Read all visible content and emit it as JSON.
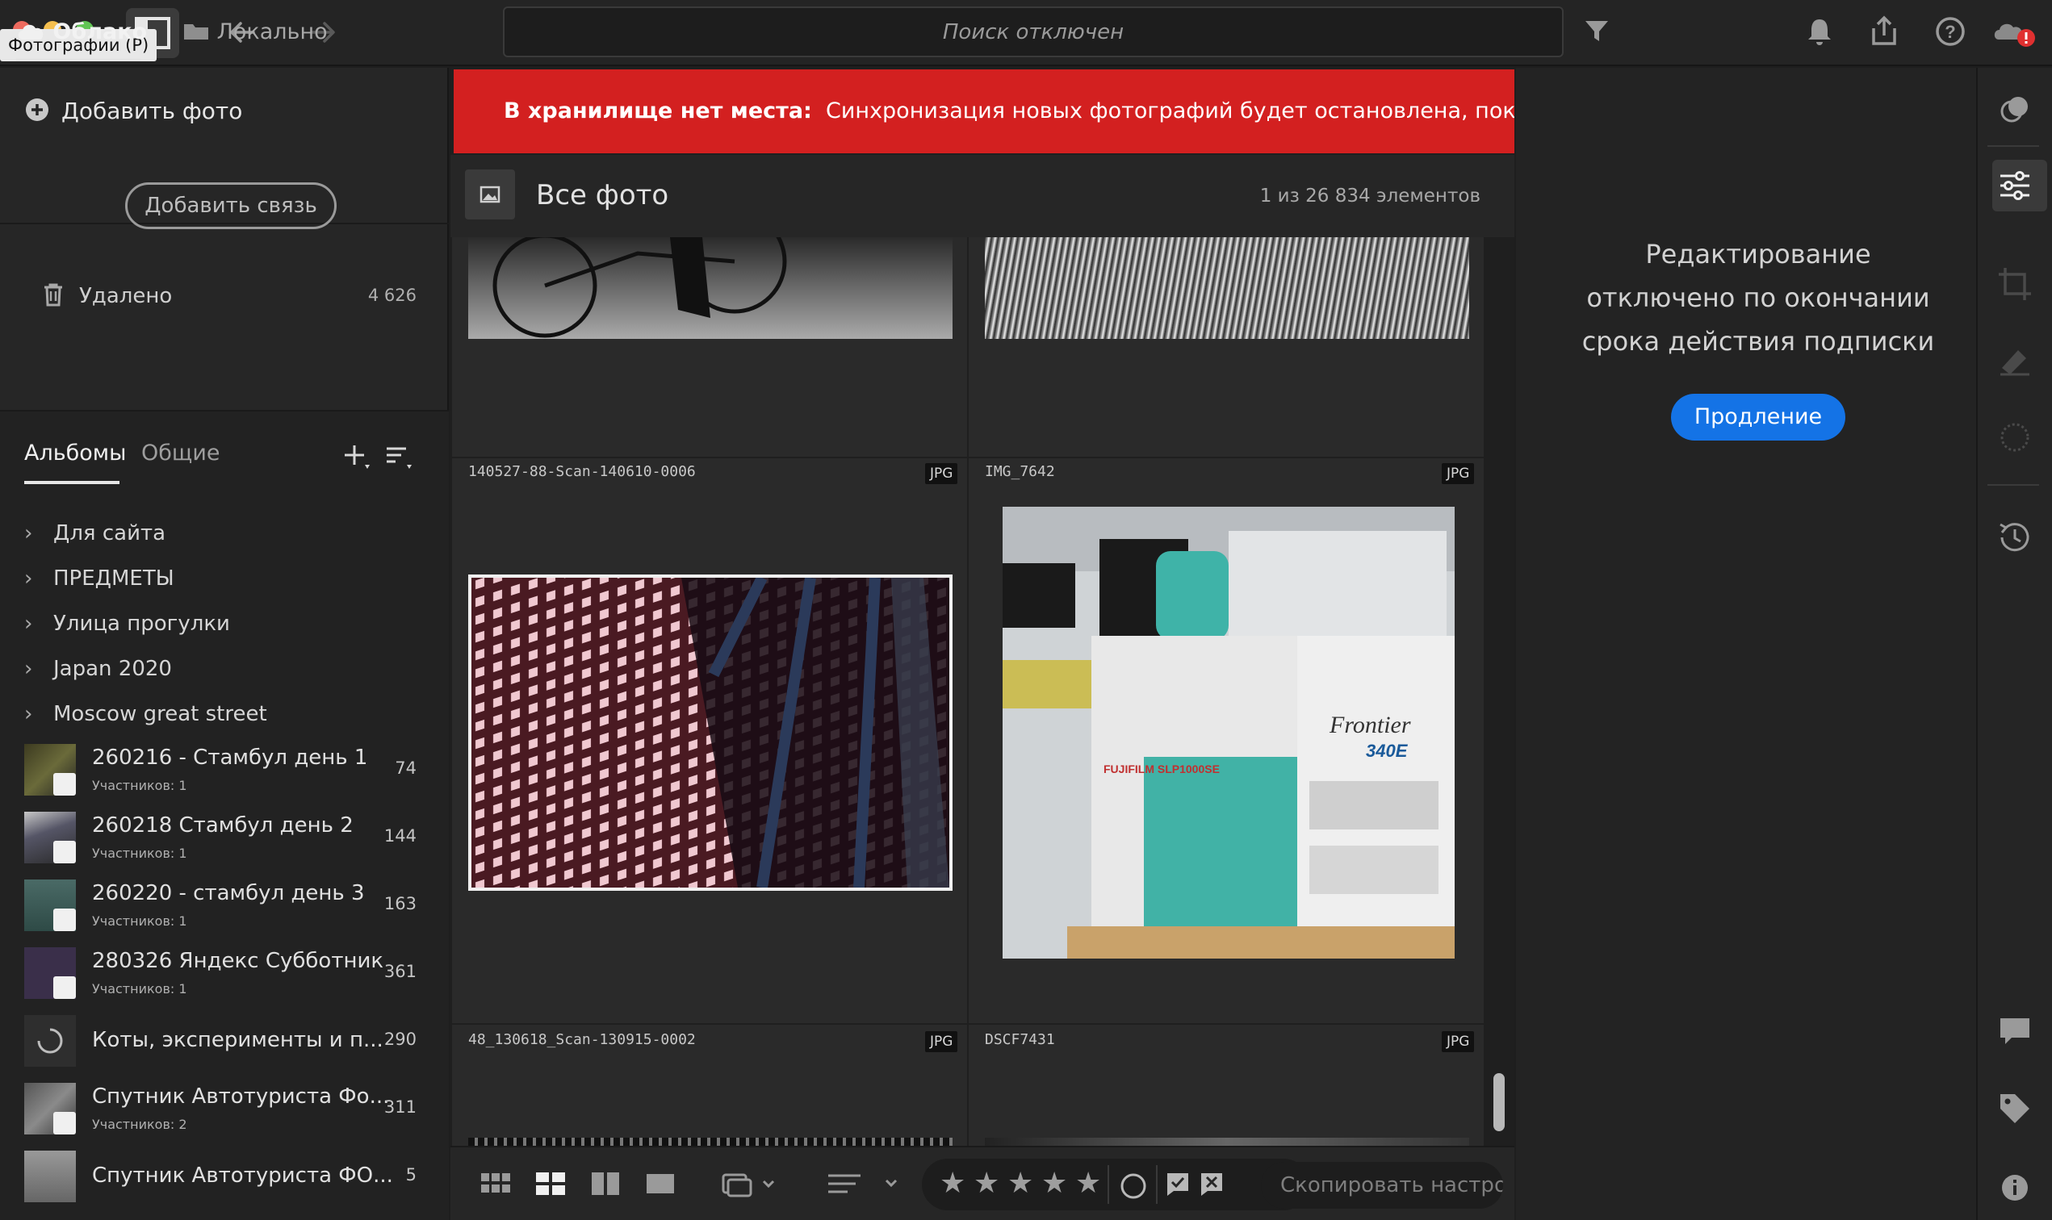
{
  "window": {
    "tooltip": "Фотографии (P)",
    "traffic_colors": [
      "#ed6a5e",
      "#f5bf4f",
      "#61c554"
    ]
  },
  "toolbar": {
    "search_placeholder": "Поиск отключен",
    "icons": [
      "back-arrow-icon",
      "forward-arrow-icon",
      "filter-icon",
      "bell-icon",
      "share-icon",
      "help-icon",
      "cloud-error-icon"
    ]
  },
  "sidebar": {
    "tab_cloud": "Облако",
    "tab_local": "Локально",
    "add_photo": "Добавить фото",
    "add_link": "Добавить связь",
    "deleted": {
      "label": "Удалено",
      "count": "4 626"
    },
    "tab_albums": "Альбомы",
    "tab_shared": "Общие",
    "folders": [
      "Для сайта",
      "ПРЕДМЕТЫ",
      "Улица прогулки",
      "Japan 2020",
      "Moscow great street"
    ],
    "albums": [
      {
        "title": "260216 - Стамбул день 1",
        "sub": "Участников: 1",
        "count": "74"
      },
      {
        "title": "260218 Стамбул день 2",
        "sub": "Участников: 1",
        "count": "144"
      },
      {
        "title": "260220 - стамбул день 3",
        "sub": "Участников: 1",
        "count": "163"
      },
      {
        "title": "280326 Яндекс Субботник",
        "sub": "Участников: 1",
        "count": "361"
      },
      {
        "title": "Коты, эксперименты и п...",
        "sub": "",
        "count": "290"
      },
      {
        "title": "Спутник Автотуриста Фо...",
        "sub": "Участников: 2",
        "count": "311"
      },
      {
        "title": "Спутник Автотуриста ФО...",
        "sub": "",
        "count": "5"
      }
    ]
  },
  "alert": {
    "bold": "В хранилище нет места:",
    "text": "Синхронизация новых фотографий будет остановлена, пока не будет о"
  },
  "grid": {
    "title": "Все фото",
    "count": "1 из 26 834 элементов",
    "cells": [
      {
        "name": "140527-88-Scan-140610-0006",
        "format": "JPG"
      },
      {
        "name": "IMG_7642",
        "format": "JPG"
      },
      {
        "name": "48_130618_Scan-130915-0002",
        "format": "JPG"
      },
      {
        "name": "DSCF7431",
        "format": "JPG"
      }
    ]
  },
  "bottom": {
    "copy_settings": "Скопировать настро",
    "stars": [
      "★",
      "★",
      "★",
      "★",
      "★"
    ]
  },
  "edit_panel": {
    "message_line1": "Редактирование",
    "message_line2": "отключено по окончании",
    "message_line3": "срока действия подписки",
    "renew_button": "Продление"
  }
}
